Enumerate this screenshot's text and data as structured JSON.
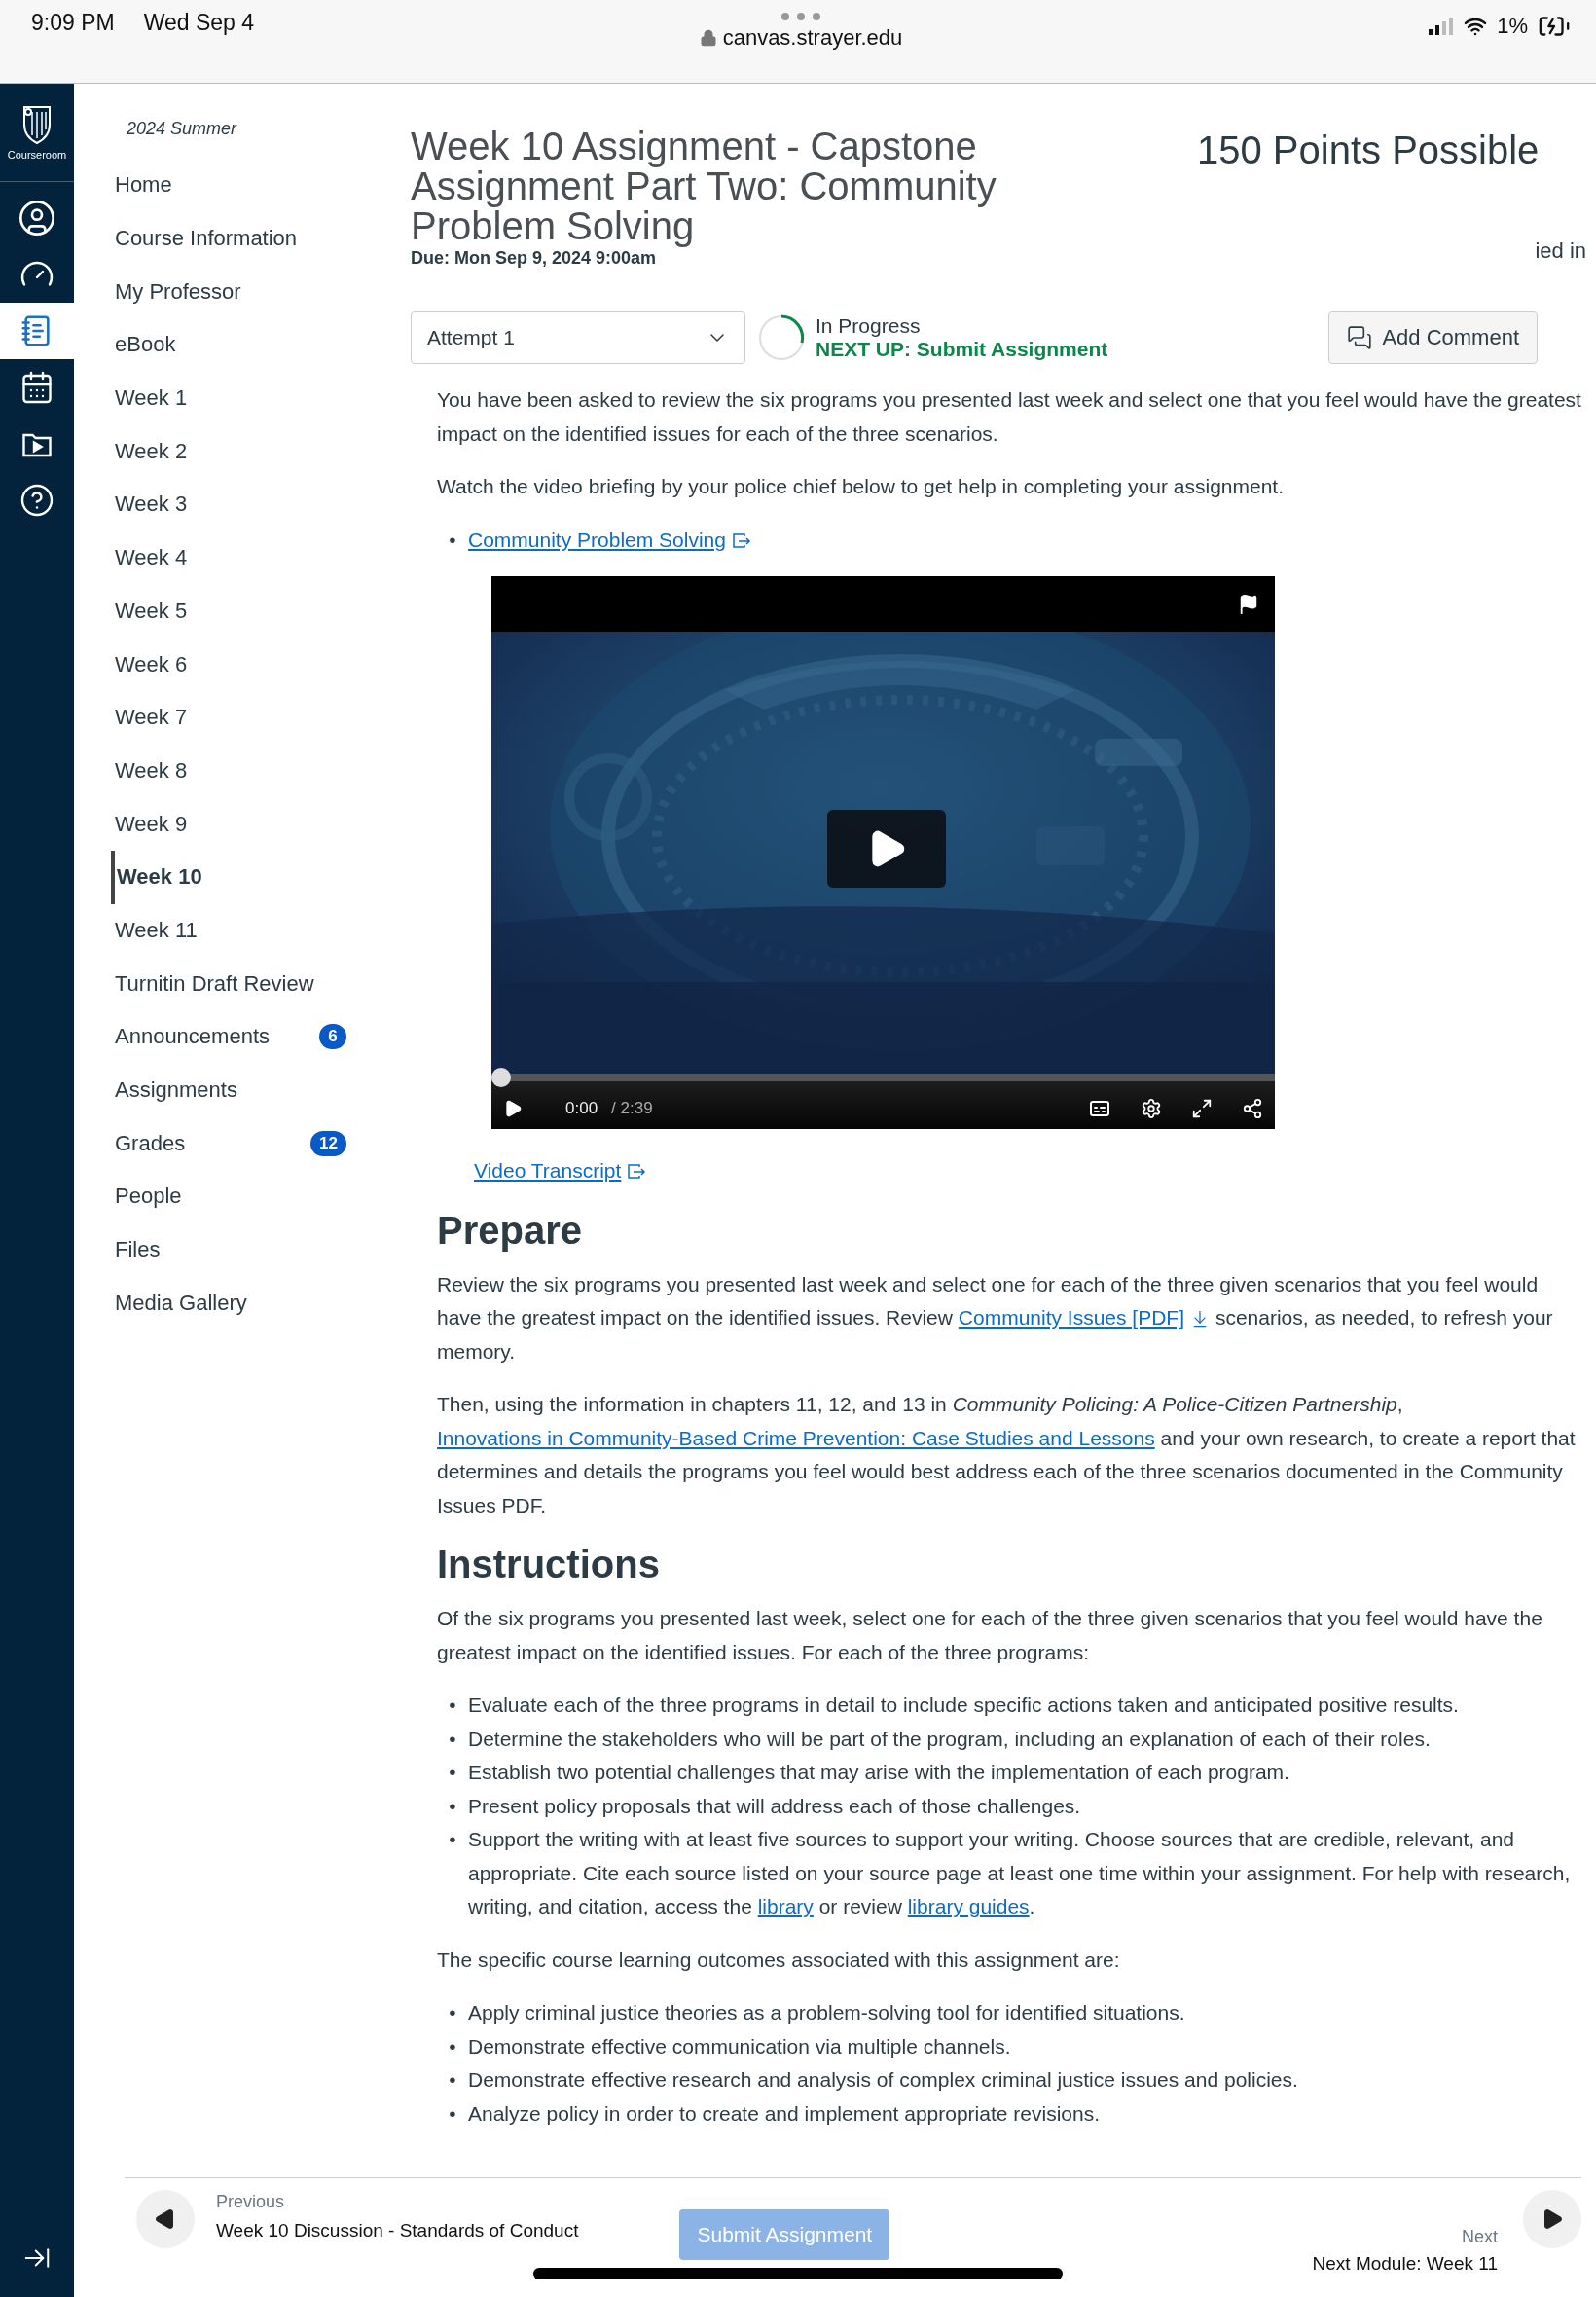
{
  "status_bar": {
    "time": "9:09 PM",
    "date": "Wed Sep 4",
    "url": "canvas.strayer.edu",
    "battery": "1%"
  },
  "rail": {
    "logo_label": "Courseroom",
    "items": [
      {
        "kind": "account",
        "selected": false
      },
      {
        "kind": "dashboard",
        "selected": false
      },
      {
        "kind": "courses",
        "selected": true
      },
      {
        "kind": "calendar",
        "selected": false
      },
      {
        "kind": "media",
        "selected": false
      },
      {
        "kind": "help",
        "selected": false
      }
    ]
  },
  "sidebar": {
    "term": "2024 Summer",
    "items": [
      {
        "label": "Home",
        "selected": false
      },
      {
        "label": "Course Information",
        "selected": false
      },
      {
        "label": "My Professor",
        "selected": false
      },
      {
        "label": "eBook",
        "selected": false
      },
      {
        "label": "Week 1",
        "selected": false
      },
      {
        "label": "Week 2",
        "selected": false
      },
      {
        "label": "Week 3",
        "selected": false
      },
      {
        "label": "Week 4",
        "selected": false
      },
      {
        "label": "Week 5",
        "selected": false
      },
      {
        "label": "Week 6",
        "selected": false
      },
      {
        "label": "Week 7",
        "selected": false
      },
      {
        "label": "Week 8",
        "selected": false
      },
      {
        "label": "Week 9",
        "selected": false
      },
      {
        "label": "Week 10",
        "selected": true
      },
      {
        "label": "Week 11",
        "selected": false
      },
      {
        "label": "Turnitin Draft Review",
        "selected": false
      },
      {
        "label": "Announcements",
        "selected": false,
        "badge": "6"
      },
      {
        "label": "Assignments",
        "selected": false
      },
      {
        "label": "Grades",
        "selected": false,
        "badge": "12"
      },
      {
        "label": "People",
        "selected": false
      },
      {
        "label": "Files",
        "selected": false
      },
      {
        "label": "Media Gallery",
        "selected": false
      }
    ]
  },
  "assignment": {
    "title": "Week 10 Assignment - Capstone Assignment Part Two: Community Problem Solving",
    "points": "150 Points Possible",
    "due": "Due: Mon Sep 9, 2024 9:00am",
    "clipped_text": "ied in",
    "attempt": "Attempt 1",
    "status": "In Progress",
    "next_up": "NEXT UP: Submit Assignment",
    "add_comment": "Add Comment"
  },
  "content": [
    {
      "kind": "paragraph",
      "parts": [
        {
          "kind": "text",
          "text": "You have been asked to review the six programs you presented last week and select one that you feel would have the greatest impact on the identified issues for each of the three scenarios."
        }
      ]
    },
    {
      "kind": "paragraph",
      "parts": [
        {
          "kind": "text",
          "text": "Watch the video briefing by your police chief below to get help in completing your assignment."
        }
      ]
    },
    {
      "kind": "bullets",
      "marker": "•",
      "items": [
        [
          {
            "kind": "external_link",
            "text": "Community Problem Solving"
          }
        ]
      ]
    },
    {
      "kind": "video",
      "time": "0:00",
      "duration": "/ 2:39",
      "level": 0
    },
    {
      "kind": "transcript",
      "parts": [
        {
          "kind": "external_link",
          "text": "Video Transcript"
        }
      ]
    },
    {
      "kind": "heading",
      "text": "Prepare"
    },
    {
      "kind": "paragraph",
      "parts": [
        {
          "kind": "text",
          "text": "Review the six programs you presented last week and select one for each of the three given scenarios that you feel would have the greatest impact on the identified issues. Review "
        },
        {
          "kind": "download_link",
          "text": "Community Issues [PDF]"
        },
        {
          "kind": "text",
          "text": " scenarios, as needed, to refresh your memory."
        }
      ]
    },
    {
      "kind": "paragraph",
      "parts": [
        {
          "kind": "text",
          "text": "Then, using the information in chapters 11, 12, and 13 in "
        },
        {
          "kind": "italic",
          "text": "Community Policing: A Police-Citizen Partnership"
        },
        {
          "kind": "text",
          "text": ", "
        },
        {
          "kind": "link",
          "text": "Innovations in Community-Based Crime Prevention: Case Studies and Lessons"
        },
        {
          "kind": "text",
          "text": " and your own research, to create a report that determines and details the programs you feel would best address each of the three scenarios documented in the Community Issues PDF."
        }
      ]
    },
    {
      "kind": "heading",
      "text": "Instructions"
    },
    {
      "kind": "paragraph",
      "parts": [
        {
          "kind": "text",
          "text": "Of the six programs you presented last week, select one for each of the three given scenarios that you feel would have the greatest impact on the identified issues. For each of the three programs:"
        }
      ]
    },
    {
      "kind": "bullets",
      "marker": "•",
      "items": [
        [
          {
            "kind": "text",
            "text": "Evaluate each of the three programs in detail to include specific actions taken and anticipated positive results."
          }
        ],
        [
          {
            "kind": "text",
            "text": "Determine the stakeholders who will be part of the program, including an explanation of each of their roles."
          }
        ],
        [
          {
            "kind": "text",
            "text": "Establish two potential challenges that may arise with the implementation of each program."
          }
        ],
        [
          {
            "kind": "text",
            "text": "Present policy proposals that will address each of those challenges."
          }
        ],
        [
          {
            "kind": "text",
            "text": "Support the writing with at least five sources to support your writing. Choose sources that are credible, relevant, and appropriate. Cite each source listed on your source page at least one time within your assignment. For help with research, writing, and citation, access the "
          },
          {
            "kind": "link",
            "text": "library"
          },
          {
            "kind": "text",
            "text": " or review "
          },
          {
            "kind": "link",
            "text": "library guides"
          },
          {
            "kind": "text",
            "text": "."
          }
        ]
      ]
    },
    {
      "kind": "paragraph",
      "parts": [
        {
          "kind": "text",
          "text": "The specific course learning outcomes associated with this assignment are:"
        }
      ]
    },
    {
      "kind": "bullets",
      "marker": "•",
      "items": [
        [
          {
            "kind": "text",
            "text": "Apply criminal justice theories as a problem-solving tool for identified situations."
          }
        ],
        [
          {
            "kind": "text",
            "text": "Demonstrate effective communication via multiple channels."
          }
        ],
        [
          {
            "kind": "text",
            "text": "Demonstrate effective research and analysis of complex criminal justice issues and policies."
          }
        ],
        [
          {
            "kind": "text",
            "text": "Analyze policy in order to create and implement appropriate revisions."
          }
        ]
      ]
    }
  ],
  "footer": {
    "previous_label": "Previous",
    "previous_title": "Week 10 Discussion - Standards of Conduct",
    "submit": "Submit Assignment",
    "submit_disabled": true,
    "next_label": "Next",
    "next_title": "Next Module: Week 11"
  }
}
